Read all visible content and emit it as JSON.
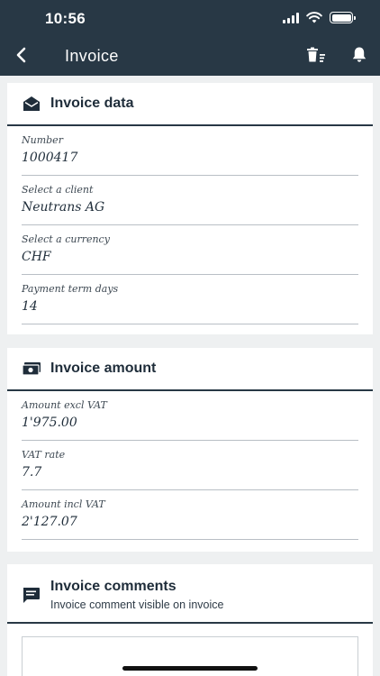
{
  "status": {
    "time": "10:56"
  },
  "nav": {
    "title": "Invoice"
  },
  "invoice_data": {
    "title": "Invoice data",
    "fields": [
      {
        "label": "Number",
        "value": "1000417"
      },
      {
        "label": "Select a client",
        "value": "Neutrans AG"
      },
      {
        "label": "Select a currency",
        "value": "CHF"
      },
      {
        "label": "Payment term days",
        "value": "14"
      }
    ]
  },
  "invoice_amount": {
    "title": "Invoice amount",
    "fields": [
      {
        "label": "Amount excl VAT",
        "value": "1'975.00"
      },
      {
        "label": "VAT rate",
        "value": "7.7"
      },
      {
        "label": "Amount incl VAT",
        "value": "2'127.07"
      }
    ]
  },
  "invoice_comments": {
    "title": "Invoice comments",
    "subtitle": "Invoice comment visible on invoice"
  },
  "icons": {
    "back": "chevron-left-icon",
    "delete_list": "trash-list-icon",
    "notifications": "bell-icon",
    "invoice_data": "envelope-open-icon",
    "invoice_amount": "money-bill-icon",
    "comments": "chat-bubble-icon"
  }
}
